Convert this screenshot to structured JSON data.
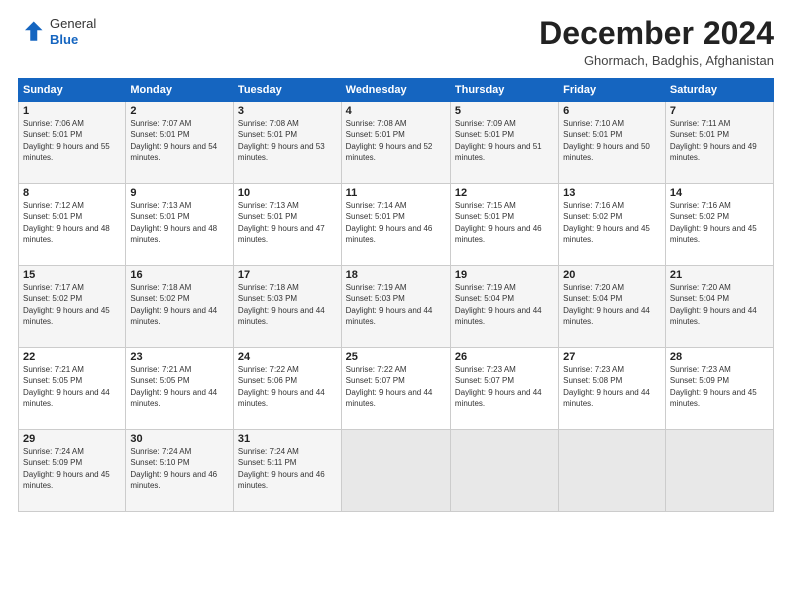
{
  "header": {
    "logo_general": "General",
    "logo_blue": "Blue",
    "month_title": "December 2024",
    "location": "Ghormach, Badghis, Afghanistan"
  },
  "weekdays": [
    "Sunday",
    "Monday",
    "Tuesday",
    "Wednesday",
    "Thursday",
    "Friday",
    "Saturday"
  ],
  "weeks": [
    [
      {
        "day": "1",
        "sunrise": "7:06 AM",
        "sunset": "5:01 PM",
        "daylight": "9 hours and 55 minutes."
      },
      {
        "day": "2",
        "sunrise": "7:07 AM",
        "sunset": "5:01 PM",
        "daylight": "9 hours and 54 minutes."
      },
      {
        "day": "3",
        "sunrise": "7:08 AM",
        "sunset": "5:01 PM",
        "daylight": "9 hours and 53 minutes."
      },
      {
        "day": "4",
        "sunrise": "7:08 AM",
        "sunset": "5:01 PM",
        "daylight": "9 hours and 52 minutes."
      },
      {
        "day": "5",
        "sunrise": "7:09 AM",
        "sunset": "5:01 PM",
        "daylight": "9 hours and 51 minutes."
      },
      {
        "day": "6",
        "sunrise": "7:10 AM",
        "sunset": "5:01 PM",
        "daylight": "9 hours and 50 minutes."
      },
      {
        "day": "7",
        "sunrise": "7:11 AM",
        "sunset": "5:01 PM",
        "daylight": "9 hours and 49 minutes."
      }
    ],
    [
      {
        "day": "8",
        "sunrise": "7:12 AM",
        "sunset": "5:01 PM",
        "daylight": "9 hours and 48 minutes."
      },
      {
        "day": "9",
        "sunrise": "7:13 AM",
        "sunset": "5:01 PM",
        "daylight": "9 hours and 48 minutes."
      },
      {
        "day": "10",
        "sunrise": "7:13 AM",
        "sunset": "5:01 PM",
        "daylight": "9 hours and 47 minutes."
      },
      {
        "day": "11",
        "sunrise": "7:14 AM",
        "sunset": "5:01 PM",
        "daylight": "9 hours and 46 minutes."
      },
      {
        "day": "12",
        "sunrise": "7:15 AM",
        "sunset": "5:01 PM",
        "daylight": "9 hours and 46 minutes."
      },
      {
        "day": "13",
        "sunrise": "7:16 AM",
        "sunset": "5:02 PM",
        "daylight": "9 hours and 45 minutes."
      },
      {
        "day": "14",
        "sunrise": "7:16 AM",
        "sunset": "5:02 PM",
        "daylight": "9 hours and 45 minutes."
      }
    ],
    [
      {
        "day": "15",
        "sunrise": "7:17 AM",
        "sunset": "5:02 PM",
        "daylight": "9 hours and 45 minutes."
      },
      {
        "day": "16",
        "sunrise": "7:18 AM",
        "sunset": "5:02 PM",
        "daylight": "9 hours and 44 minutes."
      },
      {
        "day": "17",
        "sunrise": "7:18 AM",
        "sunset": "5:03 PM",
        "daylight": "9 hours and 44 minutes."
      },
      {
        "day": "18",
        "sunrise": "7:19 AM",
        "sunset": "5:03 PM",
        "daylight": "9 hours and 44 minutes."
      },
      {
        "day": "19",
        "sunrise": "7:19 AM",
        "sunset": "5:04 PM",
        "daylight": "9 hours and 44 minutes."
      },
      {
        "day": "20",
        "sunrise": "7:20 AM",
        "sunset": "5:04 PM",
        "daylight": "9 hours and 44 minutes."
      },
      {
        "day": "21",
        "sunrise": "7:20 AM",
        "sunset": "5:04 PM",
        "daylight": "9 hours and 44 minutes."
      }
    ],
    [
      {
        "day": "22",
        "sunrise": "7:21 AM",
        "sunset": "5:05 PM",
        "daylight": "9 hours and 44 minutes."
      },
      {
        "day": "23",
        "sunrise": "7:21 AM",
        "sunset": "5:05 PM",
        "daylight": "9 hours and 44 minutes."
      },
      {
        "day": "24",
        "sunrise": "7:22 AM",
        "sunset": "5:06 PM",
        "daylight": "9 hours and 44 minutes."
      },
      {
        "day": "25",
        "sunrise": "7:22 AM",
        "sunset": "5:07 PM",
        "daylight": "9 hours and 44 minutes."
      },
      {
        "day": "26",
        "sunrise": "7:23 AM",
        "sunset": "5:07 PM",
        "daylight": "9 hours and 44 minutes."
      },
      {
        "day": "27",
        "sunrise": "7:23 AM",
        "sunset": "5:08 PM",
        "daylight": "9 hours and 44 minutes."
      },
      {
        "day": "28",
        "sunrise": "7:23 AM",
        "sunset": "5:09 PM",
        "daylight": "9 hours and 45 minutes."
      }
    ],
    [
      {
        "day": "29",
        "sunrise": "7:24 AM",
        "sunset": "5:09 PM",
        "daylight": "9 hours and 45 minutes."
      },
      {
        "day": "30",
        "sunrise": "7:24 AM",
        "sunset": "5:10 PM",
        "daylight": "9 hours and 46 minutes."
      },
      {
        "day": "31",
        "sunrise": "7:24 AM",
        "sunset": "5:11 PM",
        "daylight": "9 hours and 46 minutes."
      },
      null,
      null,
      null,
      null
    ]
  ]
}
